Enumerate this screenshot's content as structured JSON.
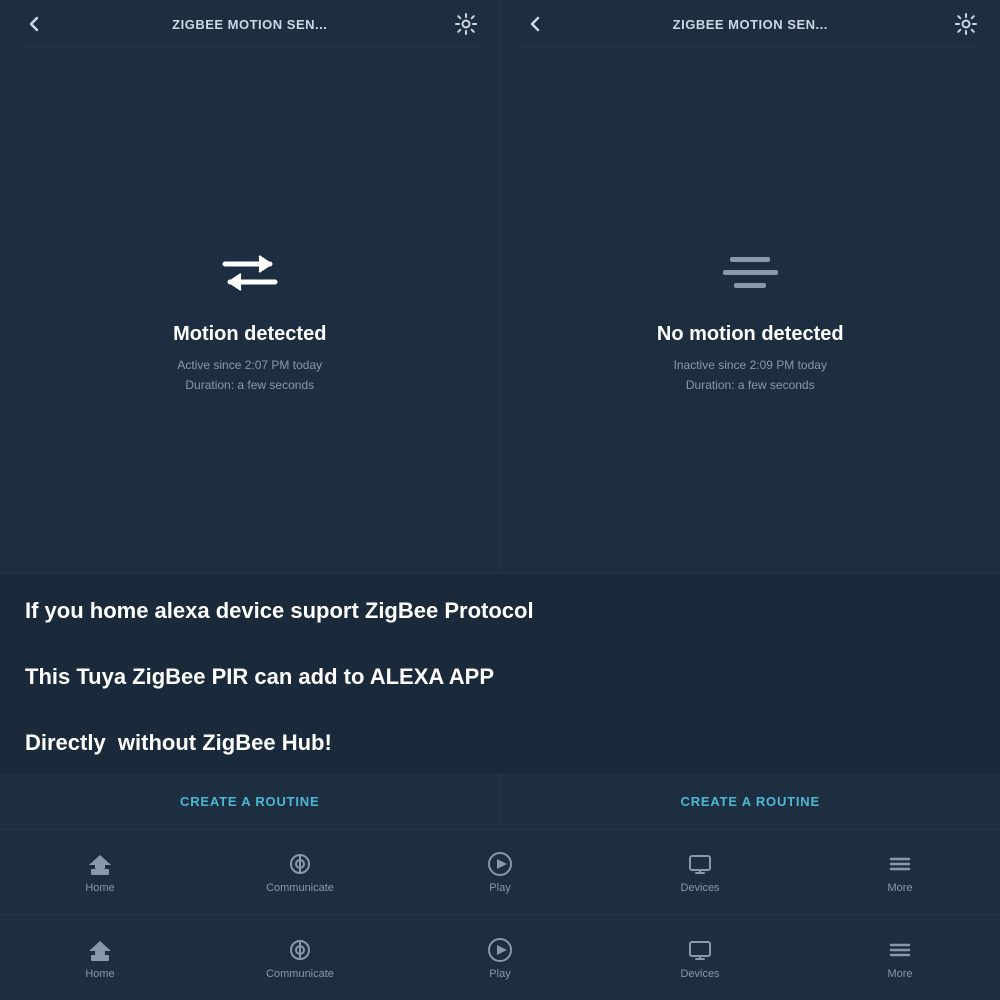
{
  "panels": [
    {
      "title": "ZIGBEE MOTION SEN...",
      "status": "Motion detected",
      "subtext1": "Active since 2:07 PM today",
      "subtext2": "Duration: a few seconds",
      "type": "motion"
    },
    {
      "title": "ZIGBEE MOTION SEN...",
      "status": "No motion detected",
      "subtext1": "Inactive since 2:09 PM today",
      "subtext2": "Duration: a few seconds",
      "type": "no-motion"
    }
  ],
  "info_text": "If you home alexa device suport ZigBee Protocol\nThis Tuya ZigBee PIR can add to ALEXA APP\nDirectly  without ZigBee Hub!",
  "routine_btn_label": "CREATE A ROUTINE",
  "nav_bars": [
    {
      "items": [
        {
          "label": "Home",
          "icon": "home-icon"
        },
        {
          "label": "Communicate",
          "icon": "communicate-icon"
        },
        {
          "label": "Play",
          "icon": "play-icon"
        },
        {
          "label": "Devices",
          "icon": "devices-icon"
        },
        {
          "label": "More",
          "icon": "more-icon"
        }
      ]
    },
    {
      "items": [
        {
          "label": "Home",
          "icon": "home-icon"
        },
        {
          "label": "Communicate",
          "icon": "communicate-icon"
        },
        {
          "label": "Play",
          "icon": "play-icon"
        },
        {
          "label": "Devices",
          "icon": "devices-icon"
        },
        {
          "label": "More",
          "icon": "more-icon"
        }
      ]
    }
  ]
}
